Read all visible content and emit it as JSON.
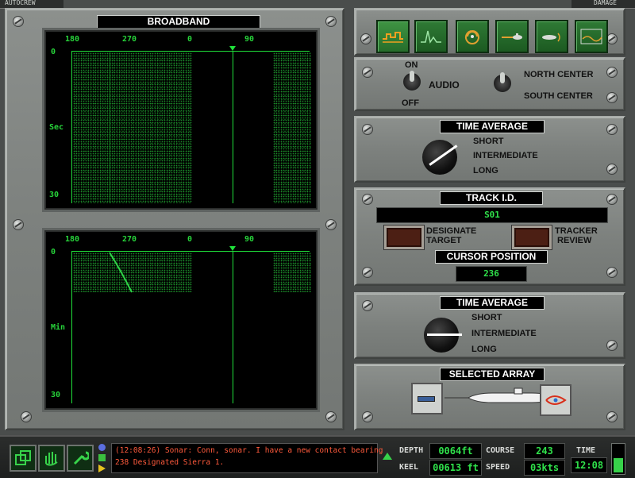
{
  "top_tabs": {
    "autocrew": "AUTOCREW",
    "damage": "DAMAGE"
  },
  "broadband": {
    "title": "BROADBAND"
  },
  "upper_scope": {
    "bearing_ticks": [
      "180",
      "270",
      "0",
      "90"
    ],
    "y_top": "0",
    "y_mid": "Sec",
    "y_bottom": "30"
  },
  "lower_scope": {
    "bearing_ticks": [
      "180",
      "270",
      "0",
      "90"
    ],
    "y_top": "0",
    "y_mid": "Min",
    "y_bottom": "30"
  },
  "mode_buttons": [
    "broadband-mode-icon",
    "narrowband-mode-icon",
    "demon-mode-icon",
    "towed-array-mode-icon",
    "active-sonar-mode-icon",
    "waterfall-mode-icon"
  ],
  "audio": {
    "on": "ON",
    "off": "OFF",
    "label": "AUDIO",
    "north": "NORTH CENTER",
    "south": "SOUTH CENTER"
  },
  "time_average_1": {
    "title": "TIME AVERAGE",
    "short": "SHORT",
    "intermediate": "INTERMEDIATE",
    "long": "LONG"
  },
  "track": {
    "title": "TRACK I.D.",
    "value": "S01",
    "designate_line1": "DESIGNATE",
    "designate_line2": "TARGET",
    "tracker_line1": "TRACKER",
    "tracker_line2": "REVIEW",
    "cursor_title": "CURSOR POSITION",
    "cursor_value": "236"
  },
  "time_average_2": {
    "title": "TIME AVERAGE",
    "short": "SHORT",
    "intermediate": "INTERMEDIATE",
    "long": "LONG"
  },
  "selected_array": {
    "title": "SELECTED ARRAY"
  },
  "message": {
    "line1": "(12:08:26) Sonar: Conn, sonar. I have a new contact bearing",
    "line2": "238 Designated Sierra 1."
  },
  "nav": {
    "depth_label": "DEPTH",
    "depth_value": "0064ft",
    "keel_label": "KEEL",
    "keel_value": "00613 ft",
    "course_label": "COURSE",
    "course_value": "243",
    "speed_label": "SPEED",
    "speed_value": "03kts",
    "time_label": "TIME",
    "time_value": "12:08"
  },
  "colors": {
    "scope_green": "#1fe03a",
    "panel_gray": "#7d817e",
    "message_red": "#ff3b2f"
  }
}
